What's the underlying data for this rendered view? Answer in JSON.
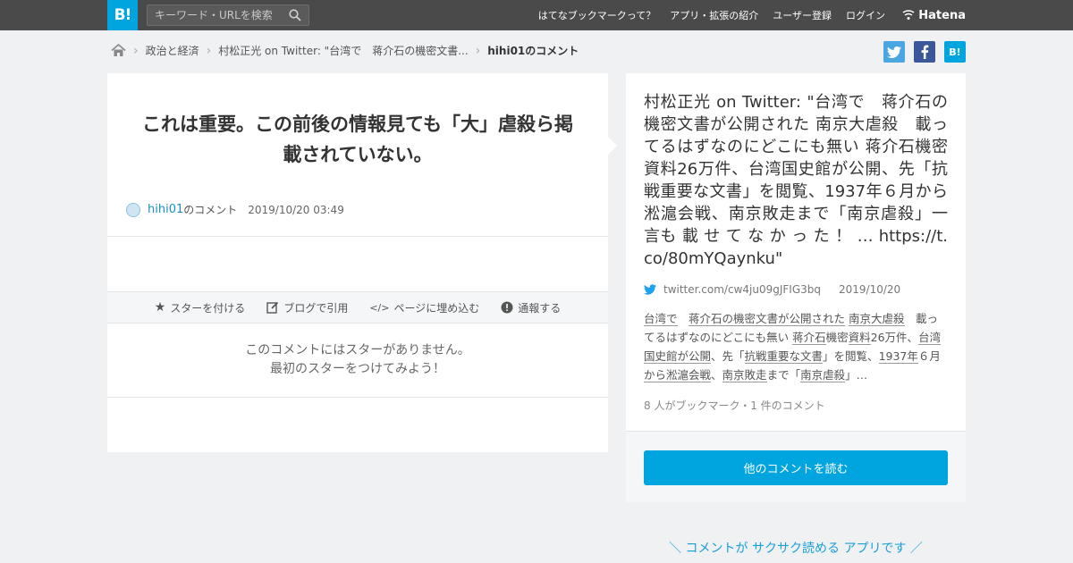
{
  "header": {
    "logo_text": "B!",
    "search_placeholder": "キーワード・URLを検索",
    "nav": [
      "はてなブックマークって？",
      "アプリ・拡張の紹介",
      "ユーザー登録",
      "ログイン"
    ],
    "hatena_label": "Hatena"
  },
  "breadcrumb": {
    "items": [
      "政治と経済",
      "村松正光 on Twitter: \"台湾で　蒋介石の機密文書...",
      "hihi01のコメント"
    ]
  },
  "share": {
    "twitter": "t",
    "facebook": "f",
    "hatebu": "B!"
  },
  "comment": {
    "text": "これは重要。この前後の情報見ても「大」虐殺ら掲載されていない。",
    "user": "hihi01",
    "user_suffix": "のコメント",
    "date": "2019/10/20 03:49"
  },
  "actions": {
    "star": "スターを付ける",
    "blog": "ブログで引用",
    "embed": "ページに埋め込む",
    "report": "通報する"
  },
  "nostars": {
    "line1": "このコメントにはスターがありません。",
    "line2": "最初のスターをつけてみよう！"
  },
  "entry": {
    "title": "村松正光 on Twitter: \"台湾で　蒋介石の機密文書が公開された 南京大虐殺　載ってるはずなのにどこにも無い 蒋介石機密資料26万件、台湾国史館が公開、先「抗戦重要な文書」を閲覧、1937年６月から淞滬会戦、南京敗走まで「南京虐殺」一言も 載 せ て な か っ た ！ … https://t.co/80mYQaynku\"",
    "source": "twitter.com/cw4ju09gJFIG3bq",
    "date": "2019/10/20",
    "desc_parts": [
      {
        "t": "台湾で",
        "k": true
      },
      {
        "t": "　",
        "k": false
      },
      {
        "t": "蒋介石の機密文書が公開された",
        "k": true
      },
      {
        "t": " ",
        "k": false
      },
      {
        "t": "南京大虐殺",
        "k": true
      },
      {
        "t": "　載ってるはずなのにどこにも無い ",
        "k": false
      },
      {
        "t": "蒋介石",
        "k": true
      },
      {
        "t": "機密",
        "k": false
      },
      {
        "t": "資料",
        "k": true
      },
      {
        "t": "26万件、",
        "k": false
      },
      {
        "t": "台湾国史館が公開",
        "k": true
      },
      {
        "t": "、先「",
        "k": false
      },
      {
        "t": "抗戦重要な文書",
        "k": true
      },
      {
        "t": "」を閲覧、",
        "k": false
      },
      {
        "t": "1937年",
        "k": true
      },
      {
        "t": "６月",
        "k": false
      },
      {
        "t": "から",
        "k": true
      },
      {
        "t": "淞滬会戦",
        "k": true
      },
      {
        "t": "、",
        "k": false
      },
      {
        "t": "南京敗走",
        "k": true
      },
      {
        "t": "まで「",
        "k": false
      },
      {
        "t": "南京虐殺",
        "k": true
      },
      {
        "t": "」…",
        "k": false
      }
    ],
    "count": "8 人がブックマーク・1 件のコメント",
    "read_button": "他のコメントを読む"
  },
  "promo": "＼ コメントが サクサク読める アプリです ／",
  "colors": {
    "accent": "#00a4de",
    "header_bg": "#4a4a4a",
    "page_bg": "#eff1f3"
  }
}
